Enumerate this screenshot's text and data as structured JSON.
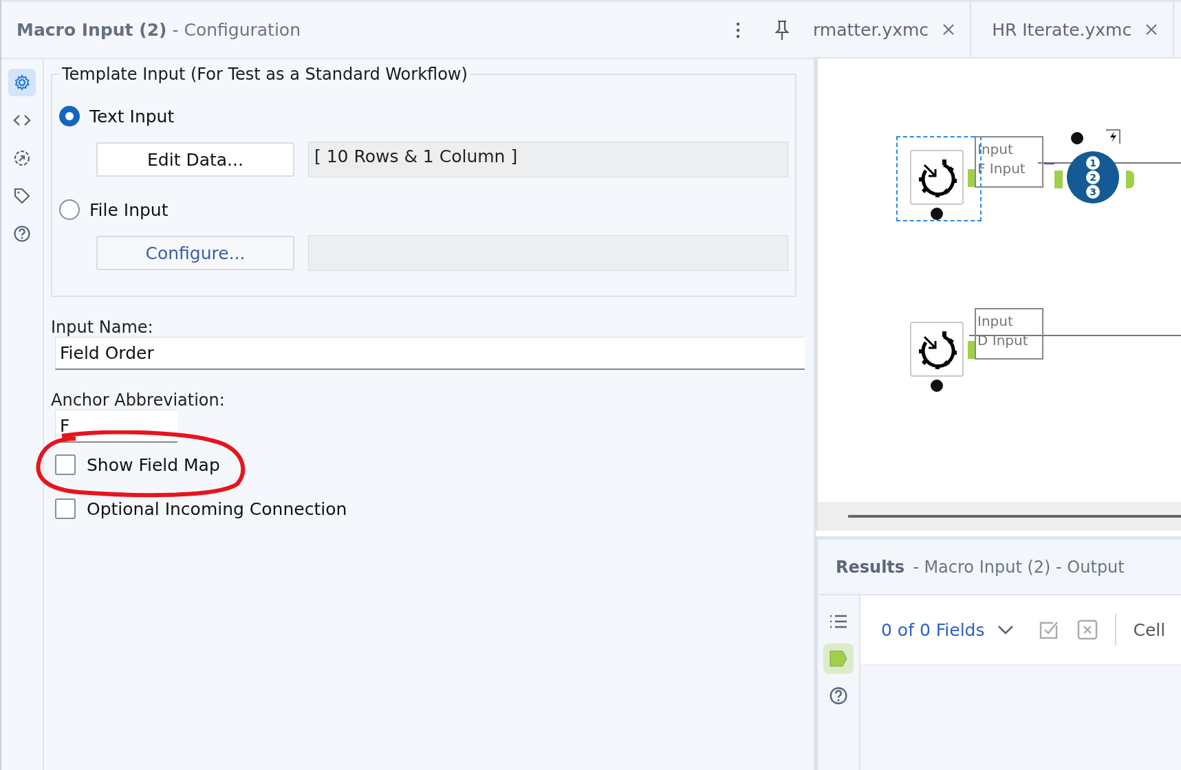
{
  "config_panel": {
    "title": "Macro Input (2)",
    "subtitle": "- Configuration",
    "side_tabs": [
      {
        "kind": "settings",
        "selected": true
      },
      {
        "kind": "code",
        "selected": false
      },
      {
        "kind": "annotation",
        "selected": false
      },
      {
        "kind": "tag",
        "selected": false
      },
      {
        "kind": "help",
        "selected": false
      }
    ],
    "template_input": {
      "legend": "Template Input (For Test as a Standard Workflow)",
      "options": [
        {
          "label": "Text Input",
          "selected": true,
          "button": "Edit Data...",
          "button_disabled": false,
          "summary": "[ 10 Rows & 1 Column ]"
        },
        {
          "label": "File Input",
          "selected": false,
          "button": "Configure...",
          "button_disabled": true
        }
      ]
    },
    "input_name": {
      "label": "Input Name:",
      "value": "Field Order"
    },
    "anchor_abbreviation": {
      "label": "Anchor Abbreviation:",
      "value": "F"
    },
    "checkboxes": [
      {
        "label": "Show Field Map",
        "checked": false,
        "circled": true
      },
      {
        "label": "Optional Incoming Connection",
        "checked": false,
        "circled": false
      }
    ]
  },
  "tabs": [
    {
      "label": "rmatter.yxmc"
    },
    {
      "label": "HR Iterate.yxmc"
    }
  ],
  "canvas": {
    "nodes": [
      {
        "kind": "macro_input",
        "selected": true,
        "labels": [
          "Input",
          "F Input"
        ]
      },
      {
        "kind": "macro_input",
        "selected": false,
        "labels": [
          "Input",
          "D Input"
        ]
      },
      {
        "kind": "interface",
        "selected": false,
        "badges": [
          "1",
          "2",
          "3"
        ]
      }
    ]
  },
  "results": {
    "title": "Results",
    "subtitle": "- Macro Input (2) - Output",
    "side_tabs": [
      {
        "kind": "list",
        "selected": false
      },
      {
        "kind": "output",
        "selected": true
      },
      {
        "kind": "help",
        "selected": false
      }
    ],
    "fields_label": "0 of 0 Fields",
    "column_3": "Cell"
  }
}
